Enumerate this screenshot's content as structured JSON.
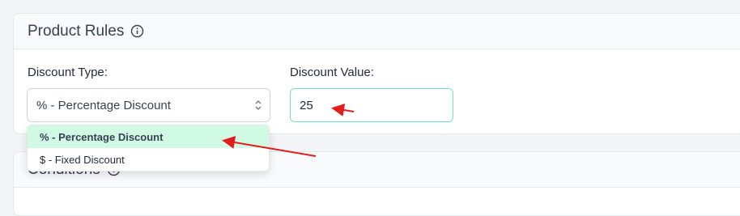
{
  "product_rules": {
    "title": "Product Rules",
    "info_icon": "info-circle-icon"
  },
  "discount_type": {
    "label": "Discount Type:",
    "selected": "% - Percentage Discount",
    "options": [
      "% - Percentage Discount",
      "$ - Fixed Discount"
    ],
    "chevron_icon": "updown-chevron-icon"
  },
  "discount_value": {
    "label": "Discount Value:",
    "value": "25"
  },
  "conditions": {
    "title": "Conditions",
    "info_icon": "info-circle-icon"
  },
  "colors": {
    "accent_border": "#6ee7b7",
    "selected_option_bg": "#d1fae5",
    "annotation_arrow": "#e11d1d"
  }
}
